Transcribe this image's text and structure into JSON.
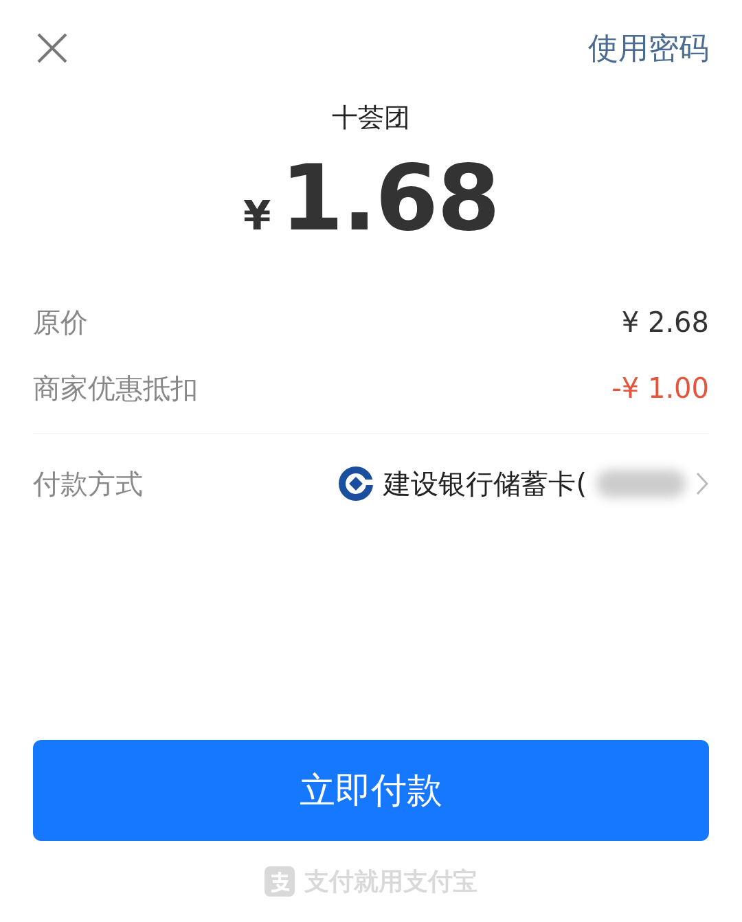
{
  "header": {
    "password_link": "使用密码"
  },
  "merchant": "十荟团",
  "amount": {
    "currency": "¥",
    "value": "1.68"
  },
  "price_rows": [
    {
      "label": "原价",
      "value": "¥ 2.68",
      "kind": "normal"
    },
    {
      "label": "商家优惠抵扣",
      "value": "-¥ 1.00",
      "kind": "discount"
    }
  ],
  "payment_method": {
    "label": "付款方式",
    "card": "建设银行储蓄卡("
  },
  "pay_button": "立即付款",
  "footer": {
    "slogan": "支付就用支付宝"
  }
}
